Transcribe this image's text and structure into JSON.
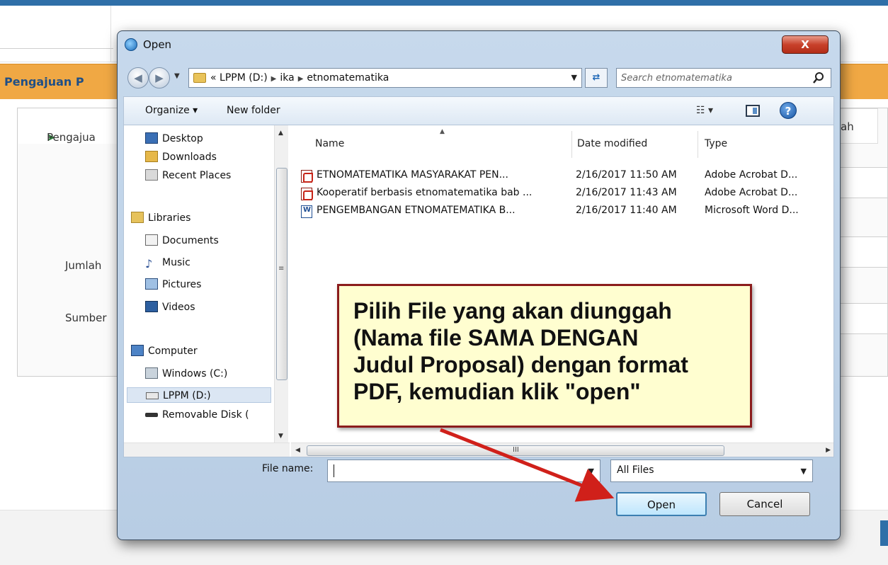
{
  "background": {
    "panel_title": "Pengajuan P",
    "tab_left": "Pengajua",
    "tab_right": "ah",
    "label_jumlah": "Jumlah",
    "label_sumber": "Sumber"
  },
  "dialog": {
    "title": "Open",
    "close_label": "X",
    "address": {
      "crumbs": [
        "«",
        "LPPM (D:)",
        "ika",
        "etnomatematika"
      ],
      "search_placeholder": "Search etnomatematika"
    },
    "toolbar": {
      "organize_label": "Organize ▾",
      "new_folder_label": "New folder",
      "views_label": "☷ ▾",
      "help_label": "?"
    },
    "nav": {
      "items": [
        {
          "label": "Desktop",
          "icon": "desktop-icon"
        },
        {
          "label": "Downloads",
          "icon": "downloads-icon"
        },
        {
          "label": "Recent Places",
          "icon": "recent-places-icon"
        },
        {
          "label": "Libraries",
          "icon": "libraries-icon"
        },
        {
          "label": "Documents",
          "icon": "documents-icon"
        },
        {
          "label": "Music",
          "icon": "music-icon"
        },
        {
          "label": "Pictures",
          "icon": "pictures-icon"
        },
        {
          "label": "Videos",
          "icon": "videos-icon"
        },
        {
          "label": "Computer",
          "icon": "computer-icon"
        },
        {
          "label": "Windows (C:)",
          "icon": "drive-c-icon"
        },
        {
          "label": "LPPM (D:)",
          "icon": "drive-d-icon"
        },
        {
          "label": "Removable Disk (",
          "icon": "removable-disk-icon"
        }
      ]
    },
    "columns": {
      "name": "Name",
      "date": "Date modified",
      "type": "Type"
    },
    "files": [
      {
        "name": "ETNOMATEMATIKA MASYARAKAT PEN...",
        "date": "2/16/2017 11:50 AM",
        "type": "Adobe Acrobat D...",
        "kind": "pdf"
      },
      {
        "name": "Kooperatif berbasis etnomatematika bab ...",
        "date": "2/16/2017 11:43 AM",
        "type": "Adobe Acrobat D...",
        "kind": "pdf"
      },
      {
        "name": "PENGEMBANGAN ETNOMATEMATIKA B...",
        "date": "2/16/2017 11:40 AM",
        "type": "Microsoft Word D...",
        "kind": "word"
      }
    ],
    "file_name_label": "File name:",
    "file_name_value": "",
    "file_type_value": "All Files",
    "open_label": "Open",
    "cancel_label": "Cancel",
    "hscroll_grip": "III"
  },
  "callout": {
    "lines": [
      "Pilih File yang akan diunggah",
      "(Nama file SAMA DENGAN",
      "Judul Proposal) dengan format",
      "PDF, kemudian klik \"open\""
    ]
  },
  "colors": {
    "accent_orange": "#f0a844",
    "callout_bg": "#fffed0",
    "callout_border": "#8b1c1c",
    "arrow_red": "#d0201a"
  }
}
